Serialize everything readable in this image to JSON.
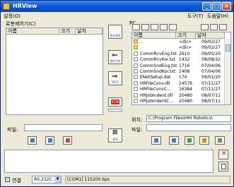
{
  "window": {
    "title": "HRView"
  },
  "menu": {
    "left": "설정(O)",
    "right": [
      "도구(T)",
      "도움말(H)"
    ]
  },
  "left_panel": {
    "group_label": "로봇제어기(C)",
    "columns": [
      "이름",
      "크기",
      "날자"
    ],
    "file_label": "파일:",
    "file_value": ""
  },
  "center": {
    "buttons": [
      {
        "label": "통신설정"
      },
      {
        "label": "제어기로"
      },
      {
        "label": "PC로"
      },
      {
        "label": "STOP"
      },
      {
        "label": "종료"
      }
    ]
  },
  "right_panel": {
    "group_label": "PC",
    "columns": [
      "이름",
      "크기",
      "날자"
    ],
    "rows": [
      {
        "name": "..",
        "size": "<dir>",
        "date": "09/02/27",
        "icon": "up"
      },
      {
        "name": "",
        "size": "<dir>",
        "date": "09/02/27",
        "icon": "folder"
      },
      {
        "name": "CommRcvEng.txt",
        "size": "2610",
        "date": "09/05/20",
        "icon": "file"
      },
      {
        "name": "CommRcvKor.txt",
        "size": "1432",
        "date": "08/08/22",
        "icon": "file"
      },
      {
        "name": "CommSndEng.txt",
        "size": "1716",
        "date": "07/04/06",
        "icon": "file"
      },
      {
        "name": "CommSndKor.txt",
        "size": "1408",
        "date": "07/04/06",
        "icon": "file"
      },
      {
        "name": "ENetSetup.dat",
        "size": "174",
        "date": "09/01/20",
        "icon": "file"
      },
      {
        "name": "HRFileConv.dll",
        "size": "24576",
        "date": "07/11/27",
        "icon": "file"
      },
      {
        "name": "HRFileConvC...",
        "size": "16384",
        "date": "07/11/27",
        "icon": "file"
      },
      {
        "name": "HRJobIndent.dll",
        "size": "20480",
        "date": "08/07/11",
        "icon": "file"
      },
      {
        "name": "HRJobIndentC...",
        "size": "20480",
        "date": "08/07/11",
        "icon": "file"
      }
    ],
    "location_label": "위치:",
    "location_value": "C:\\Program Files\\HHI Robotics\\",
    "file_label": "파일:",
    "file_value": ""
  },
  "statusbar": {
    "connect_label": "연결",
    "port_value": "RS-232C",
    "status_text": "[COM1] 115200 bps"
  }
}
